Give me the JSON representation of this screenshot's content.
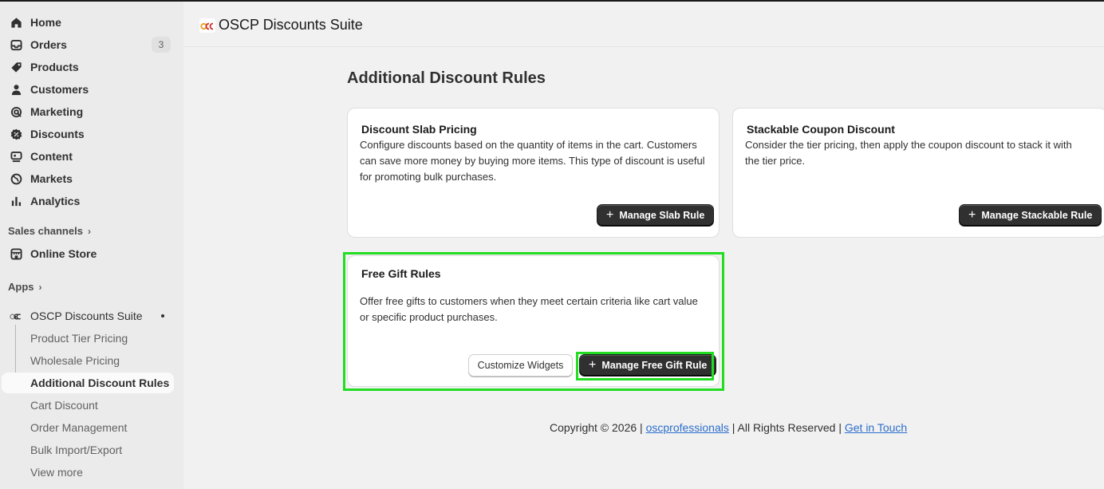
{
  "sidebar": {
    "items": [
      {
        "label": "Home",
        "icon": "home-icon"
      },
      {
        "label": "Orders",
        "icon": "orders-icon",
        "badge": "3"
      },
      {
        "label": "Products",
        "icon": "tag-icon"
      },
      {
        "label": "Customers",
        "icon": "person-icon"
      },
      {
        "label": "Marketing",
        "icon": "target-icon"
      },
      {
        "label": "Discounts",
        "icon": "discount-icon"
      },
      {
        "label": "Content",
        "icon": "content-icon"
      },
      {
        "label": "Markets",
        "icon": "globe-icon"
      },
      {
        "label": "Analytics",
        "icon": "bar-chart-icon"
      }
    ],
    "sales_channels_label": "Sales channels",
    "online_store_label": "Online Store",
    "apps_label": "Apps",
    "app_name": "OSCP Discounts Suite",
    "app_subitems": [
      "Product Tier Pricing",
      "Wholesale Pricing",
      "Additional Discount Rules",
      "Cart Discount",
      "Order Management",
      "Bulk Import/Export",
      "View more"
    ],
    "active_subitem": "Additional Discount Rules"
  },
  "header": {
    "app_title": "OSCP Discounts Suite",
    "logo_text": "osc"
  },
  "main": {
    "page_title": "Additional Discount Rules",
    "cards": {
      "slab": {
        "title": "Discount Slab Pricing",
        "desc_lines": [
          "Configure discounts based on the quantity of items in the cart. Customers",
          "can save more money by buying more items. This type of discount is useful",
          "for promoting bulk purchases."
        ],
        "button": "Manage Slab Rule"
      },
      "stackable": {
        "title": "Stackable Coupon Discount",
        "desc_lines": [
          "Consider the tier pricing, then apply the coupon discount to stack it with",
          "the tier price."
        ],
        "button": "Manage Stackable Rule"
      },
      "gift": {
        "title": "Free Gift Rules",
        "desc_lines": [
          "Offer free gifts to customers when they meet certain criteria like cart value",
          "or specific product purchases."
        ],
        "secondary_button": "Customize Widgets",
        "button": "Manage Free Gift Rule"
      }
    },
    "plus_glyph": "+"
  },
  "footer": {
    "prefix": "Copyright © 2026 | ",
    "link1": "oscprofessionals",
    "middle": " | All Rights Reserved | ",
    "link2": "Get in Touch"
  },
  "colors": {
    "highlight": "#22dd22",
    "primary_button": "#303030",
    "link": "#2c6ecb"
  }
}
